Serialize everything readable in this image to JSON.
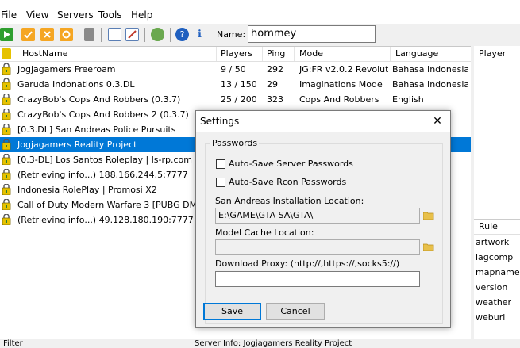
{
  "menu": [
    "File",
    "View",
    "Servers",
    "Tools",
    "Help"
  ],
  "toolbar": {
    "name_label": "Name:",
    "name_value": "hommey"
  },
  "columns": [
    "HostName",
    "Players",
    "Ping",
    "Mode",
    "Language"
  ],
  "rows": [
    {
      "host": "Jogjagamers Freeroam",
      "players": "9 / 50",
      "ping": "292",
      "mode": "JG:FR v2.0.2 Revolution",
      "lang": "Bahasa Indonesia"
    },
    {
      "host": "Garuda Indonations 0.3.DL",
      "players": "13 / 150",
      "ping": "29",
      "mode": "Imaginations Mode",
      "lang": "Bahasa Indonesia"
    },
    {
      "host": "CrazyBob's Cops And Robbers (0.3.7)",
      "players": "25 / 200",
      "ping": "323",
      "mode": "Cops And Robbers",
      "lang": "English"
    },
    {
      "host": "CrazyBob's Cops And Robbers 2 (0.3.7)",
      "players": "",
      "ping": "",
      "mode": "",
      "lang": ""
    },
    {
      "host": "[0.3.DL] San Andreas Police Pursuits",
      "players": "",
      "ping": "",
      "mode": "",
      "lang": ""
    },
    {
      "host": "Jogjagamers Reality Project",
      "players": "",
      "ping": "",
      "mode": "",
      "lang": "sia"
    },
    {
      "host": "[0.3-DL] Los Santos Roleplay | ls-rp.com",
      "players": "",
      "ping": "",
      "mode": "",
      "lang": ""
    },
    {
      "host": "(Retrieving info...) 188.166.244.5:7777",
      "players": "",
      "ping": "",
      "mode": "",
      "lang": ""
    },
    {
      "host": "Indonesia RolePlay | Promosi X2",
      "players": "",
      "ping": "",
      "mode": "",
      "lang": ""
    },
    {
      "host": "Call of Duty Modern Warfare 3 [PUBG DMS EVE",
      "players": "",
      "ping": "",
      "mode": "",
      "lang": "ol /"
    },
    {
      "host": "(Retrieving info...) 49.128.180.190:7777",
      "players": "",
      "ping": "",
      "mode": "",
      "lang": ""
    }
  ],
  "selected_row": 5,
  "right_panel": {
    "player_header": "Player",
    "rule_header": "Rule",
    "rules": [
      "artwork",
      "lagcomp",
      "mapname",
      "version",
      "weather",
      "weburl"
    ]
  },
  "status": {
    "filter": "Filter",
    "server_info": "Server Info: Jogjagamers Reality Project"
  },
  "dialog": {
    "title": "Settings",
    "close": "✕",
    "group": "Passwords",
    "autosave_server": "Auto-Save Server Passwords",
    "autosave_rcon": "Auto-Save Rcon Passwords",
    "install_label": "San Andreas Installation Location:",
    "install_value": "E:\\GAME\\GTA SA\\GTA\\",
    "cache_label": "Model Cache Location:",
    "cache_value": "",
    "proxy_label": "Download Proxy: (http://,https://,socks5://)",
    "proxy_value": "",
    "save": "Save",
    "cancel": "Cancel"
  },
  "colors": {
    "selection": "#0078d7",
    "lock": "#e6c200"
  }
}
